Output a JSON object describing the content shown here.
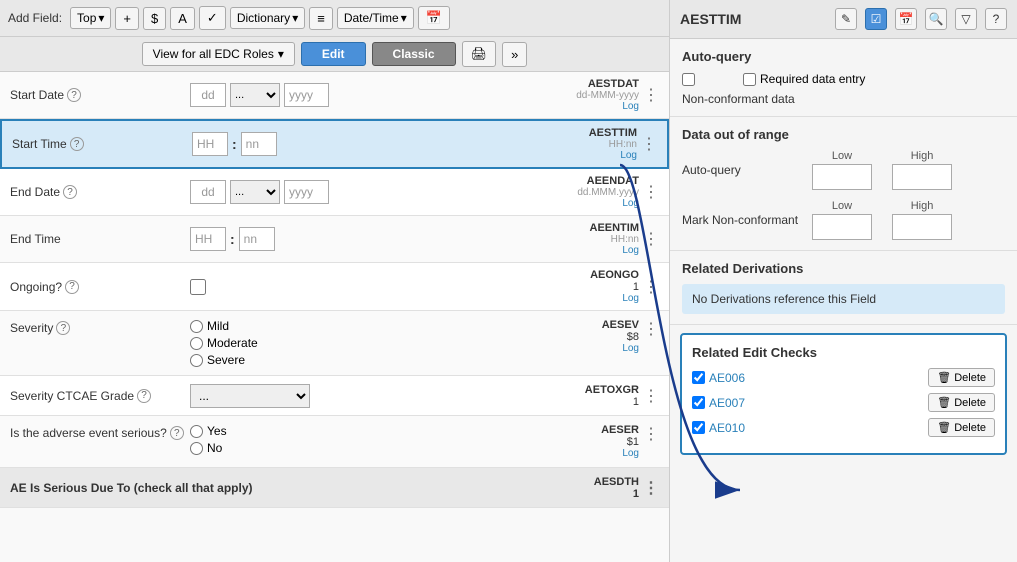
{
  "toolbar": {
    "add_field_label": "Add Field:",
    "top_label": "Top",
    "dict_label": "Dictionary",
    "datetime_label": "Date/Time",
    "plus_icon": "+",
    "dollar_icon": "$",
    "A_icon": "A",
    "check_icon": "✓",
    "list_icon": "≡",
    "cal_icon": "📅"
  },
  "toolbar2": {
    "roles_label": "View for all EDC Roles",
    "edit_label": "Edit",
    "classic_label": "Classic",
    "print_icon": "🖨",
    "next_icon": "»"
  },
  "fields": [
    {
      "label": "Start Date",
      "has_help": true,
      "type": "date",
      "dd": "dd",
      "mm": "...",
      "yyyy": "yyyy",
      "meta_code": "AESTDAT",
      "meta_format": "dd-MMM-yyyy",
      "meta_log": "Log",
      "meta_num": ""
    },
    {
      "label": "Start Time",
      "has_help": true,
      "type": "time",
      "HH": "HH",
      "nn": "nn",
      "meta_code": "AESTTIM",
      "meta_format": "HH:nn",
      "meta_log": "Log",
      "meta_num": "",
      "highlighted": true
    },
    {
      "label": "End Date",
      "has_help": true,
      "type": "date",
      "dd": "dd",
      "mm": "...",
      "yyyy": "yyyy",
      "meta_code": "AEENDAT",
      "meta_format": "dd.MMM.yyyy",
      "meta_log": "Log",
      "meta_num": ""
    },
    {
      "label": "End Time",
      "has_help": false,
      "type": "time",
      "HH": "HH",
      "nn": "nn",
      "meta_code": "AEENTIM",
      "meta_format": "HH:nn",
      "meta_log": "Log",
      "meta_num": ""
    },
    {
      "label": "Ongoing?",
      "has_help": true,
      "type": "checkbox",
      "meta_code": "AEONGO",
      "meta_format": "",
      "meta_log": "Log",
      "meta_num": "1"
    },
    {
      "label": "Severity",
      "has_help": true,
      "type": "radio",
      "options": [
        "Mild",
        "Moderate",
        "Severe"
      ],
      "meta_code": "AESEV",
      "meta_format": "",
      "meta_log": "Log",
      "meta_num": "$8"
    },
    {
      "label": "Severity CTCAE Grade",
      "has_help": true,
      "type": "select",
      "select_value": "...",
      "meta_code": "AETOXGR",
      "meta_format": "",
      "meta_log": "",
      "meta_num": "1"
    },
    {
      "label": "Is the adverse event serious?",
      "has_help": true,
      "type": "radio",
      "options": [
        "Yes",
        "No"
      ],
      "meta_code": "AESER",
      "meta_format": "",
      "meta_log": "Log",
      "meta_num": "$1"
    }
  ],
  "section_header": "AE Is Serious Due To (check all that apply)",
  "section_meta": "AESDTH",
  "section_meta_num": "1",
  "right_panel": {
    "title": "AESTTIM",
    "icons": [
      "edit",
      "checkbox",
      "calendar",
      "search",
      "filter",
      "question"
    ],
    "auto_query": {
      "section_title": "Auto-query",
      "checkbox_label": "",
      "required_label": "Required data entry",
      "non_conformant_label": "Non-conformant data"
    },
    "data_out_of_range": {
      "section_title": "Data out of range",
      "auto_query_label": "Auto-query",
      "low_label": "Low",
      "high_label": "High",
      "mark_non_conformant_label": "Mark Non-conformant",
      "low2_label": "Low",
      "high2_label": "High"
    },
    "related_derivations": {
      "section_title": "Related Derivations",
      "message": "No Derivations reference this Field"
    },
    "related_edit_checks": {
      "section_title": "Related Edit Checks",
      "checks": [
        {
          "code": "AE006",
          "delete_label": "Delete"
        },
        {
          "code": "AE007",
          "delete_label": "Delete"
        },
        {
          "code": "AE010",
          "delete_label": "Delete"
        }
      ]
    }
  }
}
